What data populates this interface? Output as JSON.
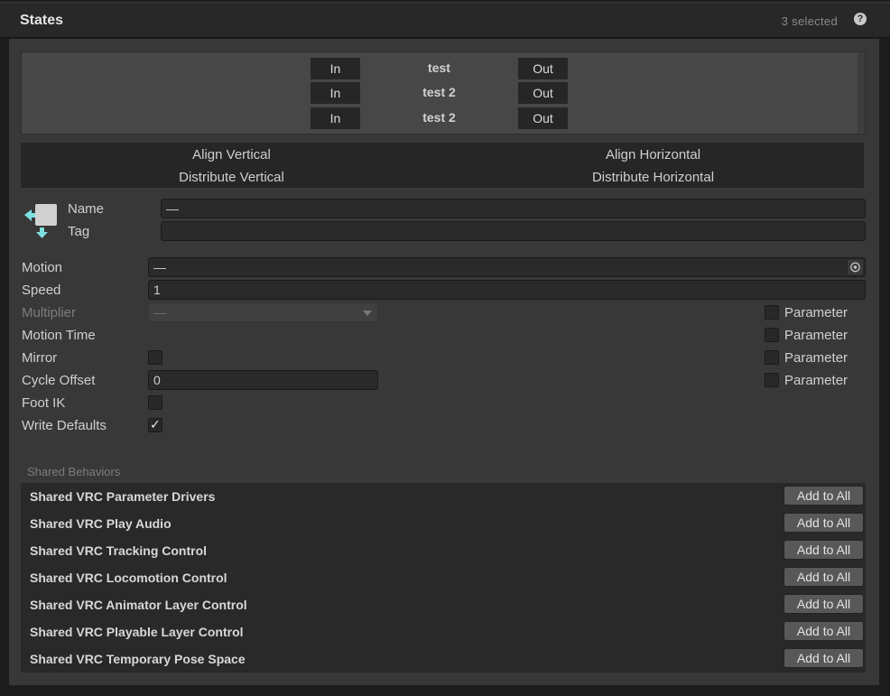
{
  "header": {
    "title": "States",
    "selected": "3 selected",
    "help": "?"
  },
  "transitions": [
    {
      "in": "In",
      "name": "test",
      "out": "Out"
    },
    {
      "in": "In",
      "name": "test  2",
      "out": "Out"
    },
    {
      "in": "In",
      "name": "test 2",
      "out": "Out"
    }
  ],
  "align": {
    "align_vertical": "Align Vertical",
    "align_horizontal": "Align Horizontal",
    "distribute_vertical": "Distribute Vertical",
    "distribute_horizontal": "Distribute Horizontal"
  },
  "identity": {
    "name_label": "Name",
    "name_value": "—",
    "tag_label": "Tag",
    "tag_value": ""
  },
  "props": {
    "motion_label": "Motion",
    "motion_value": "—",
    "speed_label": "Speed",
    "speed_value": "1",
    "multiplier_label": "Multiplier",
    "multiplier_value": "—",
    "motion_time_label": "Motion Time",
    "mirror_label": "Mirror",
    "cycle_offset_label": "Cycle Offset",
    "cycle_offset_value": "0",
    "foot_ik_label": "Foot IK",
    "write_defaults_label": "Write Defaults",
    "parameter_label": "Parameter",
    "write_defaults_checked": true
  },
  "shared": {
    "section_label": "Shared Behaviors",
    "add_label": "Add to All",
    "items": [
      "Shared VRC Parameter Drivers",
      "Shared VRC Play Audio",
      "Shared VRC Tracking Control",
      "Shared VRC Locomotion Control",
      "Shared VRC Animator Layer Control",
      "Shared VRC Playable Layer Control",
      "Shared VRC Temporary Pose Space"
    ]
  },
  "colors": {
    "panel": "#383838",
    "button": "#585858",
    "field": "#2a2a2a"
  },
  "icons": {
    "state": "state-transition-icon",
    "target": "object-picker-icon",
    "help": "help-icon"
  }
}
